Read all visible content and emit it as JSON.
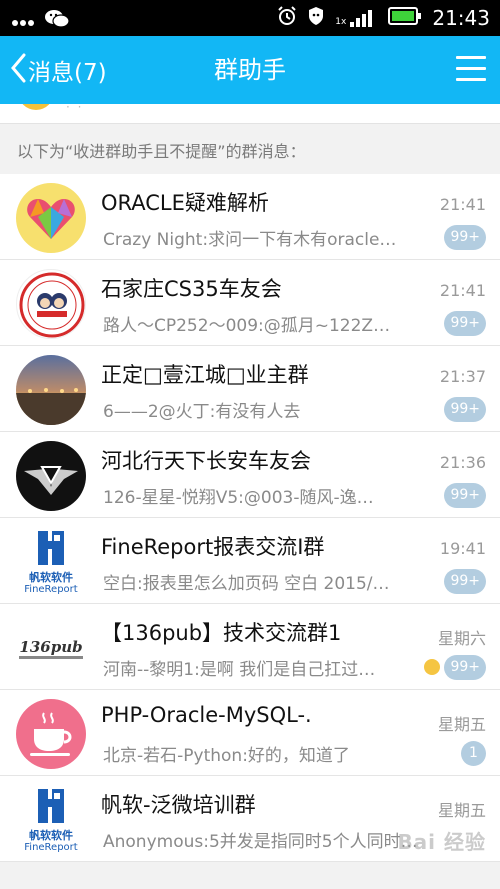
{
  "statusbar": {
    "time": "21:43",
    "signal_label": "1x"
  },
  "nav": {
    "back_label": "消息(7)",
    "title": "群助手"
  },
  "notice": "以下为“收进群助手且不提醒”的群消息：",
  "groups": [
    {
      "name": "ORACLE疑难解析",
      "message": "Crazy Night:求问一下有木有oracle…",
      "time": "21:41",
      "badge": "99+"
    },
    {
      "name": "石家庄CS35车友会",
      "message": "路人～CP252～009:@孤月~122Z…",
      "time": "21:41",
      "badge": "99+"
    },
    {
      "name": "正定□壹江城□业主群",
      "message": "6——2@火丁:有没有人去",
      "time": "21:37",
      "badge": "99+"
    },
    {
      "name": "河北行天下长安车友会",
      "message": "126-星星-悦翔V5:@003-随风-逸…",
      "time": "21:36",
      "badge": "99+"
    },
    {
      "name": "FineReport报表交流Ⅰ群",
      "message": "空白:报表里怎么加页码  空白 2015/…",
      "time": "19:41",
      "badge": "99+"
    },
    {
      "name": "【136pub】技术交流群1",
      "message": "河南--黎明1:是啊 我们是自己扛过…",
      "time": "星期六",
      "badge": "99+"
    },
    {
      "name": "PHP-Oracle-MySQL-.",
      "message": "北京-若石-Python:好的，知道了",
      "time": "星期五",
      "badge": "1"
    },
    {
      "name": "帆软-泛微培训群",
      "message": "Anonymous:5并发是指同时5个人同时…",
      "time": "星期五",
      "badge": ""
    }
  ],
  "avatars": {
    "fanruan_cn": "帆软软件",
    "fanruan_en": "FineReport",
    "pub136": "136pub",
    "clubtext": "车友会"
  },
  "watermark": "Bai 经验",
  "colors": {
    "navbar": "#12b7f5",
    "badge": "#b3cde0",
    "statusbar": "#000000"
  }
}
